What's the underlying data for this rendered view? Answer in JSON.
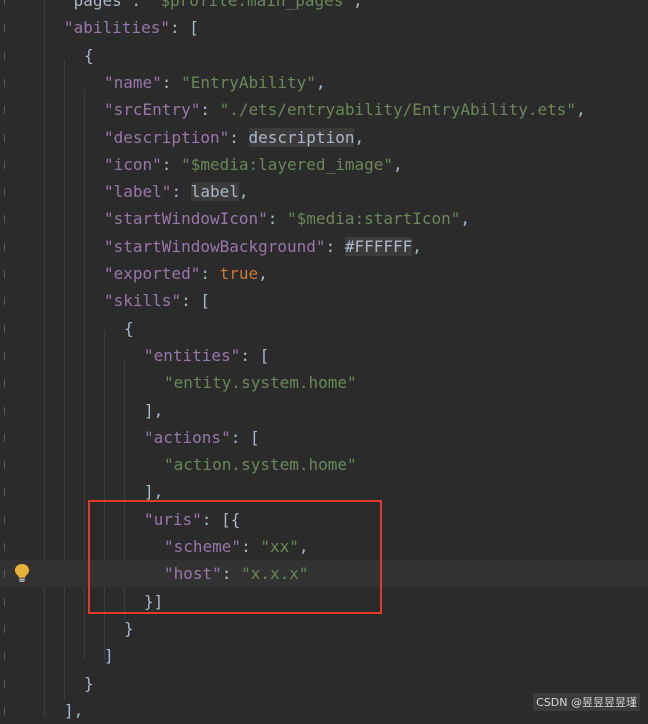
{
  "lines": [
    {
      "t": [
        [
          "p",
          "\"pages\": "
        ],
        [
          "str",
          "\"$profile:main_pages\""
        ],
        [
          "p",
          ","
        ]
      ]
    },
    {
      "t": [
        [
          "key",
          "\"abilities\""
        ],
        [
          "p",
          ": ["
        ]
      ]
    },
    {
      "t": [
        [
          "p",
          "{"
        ]
      ]
    },
    {
      "t": [
        [
          "key",
          "\"name\""
        ],
        [
          "p",
          ": "
        ],
        [
          "str",
          "\"EntryAbility\""
        ],
        [
          "p",
          ","
        ]
      ]
    },
    {
      "t": [
        [
          "key",
          "\"srcEntry\""
        ],
        [
          "p",
          ": "
        ],
        [
          "str",
          "\"./ets/entryability/EntryAbility.ets\""
        ],
        [
          "p",
          ","
        ]
      ]
    },
    {
      "t": [
        [
          "key",
          "\"description\""
        ],
        [
          "p",
          ": "
        ],
        [
          "ref",
          "description"
        ],
        [
          "p",
          ","
        ]
      ]
    },
    {
      "t": [
        [
          "key",
          "\"icon\""
        ],
        [
          "p",
          ": "
        ],
        [
          "str",
          "\"$media:layered_image\""
        ],
        [
          "p",
          ","
        ]
      ]
    },
    {
      "t": [
        [
          "key",
          "\"label\""
        ],
        [
          "p",
          ": "
        ],
        [
          "ref",
          "label"
        ],
        [
          "p",
          ","
        ]
      ]
    },
    {
      "t": [
        [
          "key",
          "\"startWindowIcon\""
        ],
        [
          "p",
          ": "
        ],
        [
          "str",
          "\"$media:startIcon\""
        ],
        [
          "p",
          ","
        ]
      ]
    },
    {
      "t": [
        [
          "key",
          "\"startWindowBackground\""
        ],
        [
          "p",
          ": "
        ],
        [
          "ref",
          "#FFFFFF"
        ],
        [
          "p",
          ","
        ]
      ]
    },
    {
      "t": [
        [
          "key",
          "\"exported\""
        ],
        [
          "p",
          ": "
        ],
        [
          "kw",
          "true"
        ],
        [
          "p",
          ","
        ]
      ]
    },
    {
      "t": [
        [
          "key",
          "\"skills\""
        ],
        [
          "p",
          ": ["
        ]
      ]
    },
    {
      "t": [
        [
          "p",
          "{"
        ]
      ]
    },
    {
      "t": [
        [
          "key",
          "\"entities\""
        ],
        [
          "p",
          ": ["
        ]
      ]
    },
    {
      "t": [
        [
          "str",
          "\"entity.system.home\""
        ]
      ]
    },
    {
      "t": [
        [
          "p",
          "],"
        ]
      ]
    },
    {
      "t": [
        [
          "key",
          "\"actions\""
        ],
        [
          "p",
          ": ["
        ]
      ]
    },
    {
      "t": [
        [
          "str",
          "\"action.system.home\""
        ]
      ]
    },
    {
      "t": [
        [
          "p",
          "],"
        ]
      ]
    },
    {
      "t": [
        [
          "key",
          "\"uris\""
        ],
        [
          "p",
          ": [{"
        ]
      ]
    },
    {
      "t": [
        [
          "key",
          "\"scheme\""
        ],
        [
          "p",
          ": "
        ],
        [
          "str",
          "\"xx\""
        ],
        [
          "p",
          ","
        ]
      ]
    },
    {
      "t": [
        [
          "key",
          "\"host\""
        ],
        [
          "p",
          ": "
        ],
        [
          "str",
          "\"x.x.x\""
        ]
      ]
    },
    {
      "t": [
        [
          "p",
          "}]"
        ]
      ]
    },
    {
      "t": [
        [
          "p",
          "}"
        ]
      ]
    },
    {
      "t": [
        [
          "p",
          "]"
        ]
      ]
    },
    {
      "t": [
        [
          "p",
          "}"
        ]
      ]
    },
    {
      "t": [
        [
          "p",
          "],"
        ]
      ]
    }
  ],
  "watermark": "CSDN @昱昱昱昱瑾"
}
